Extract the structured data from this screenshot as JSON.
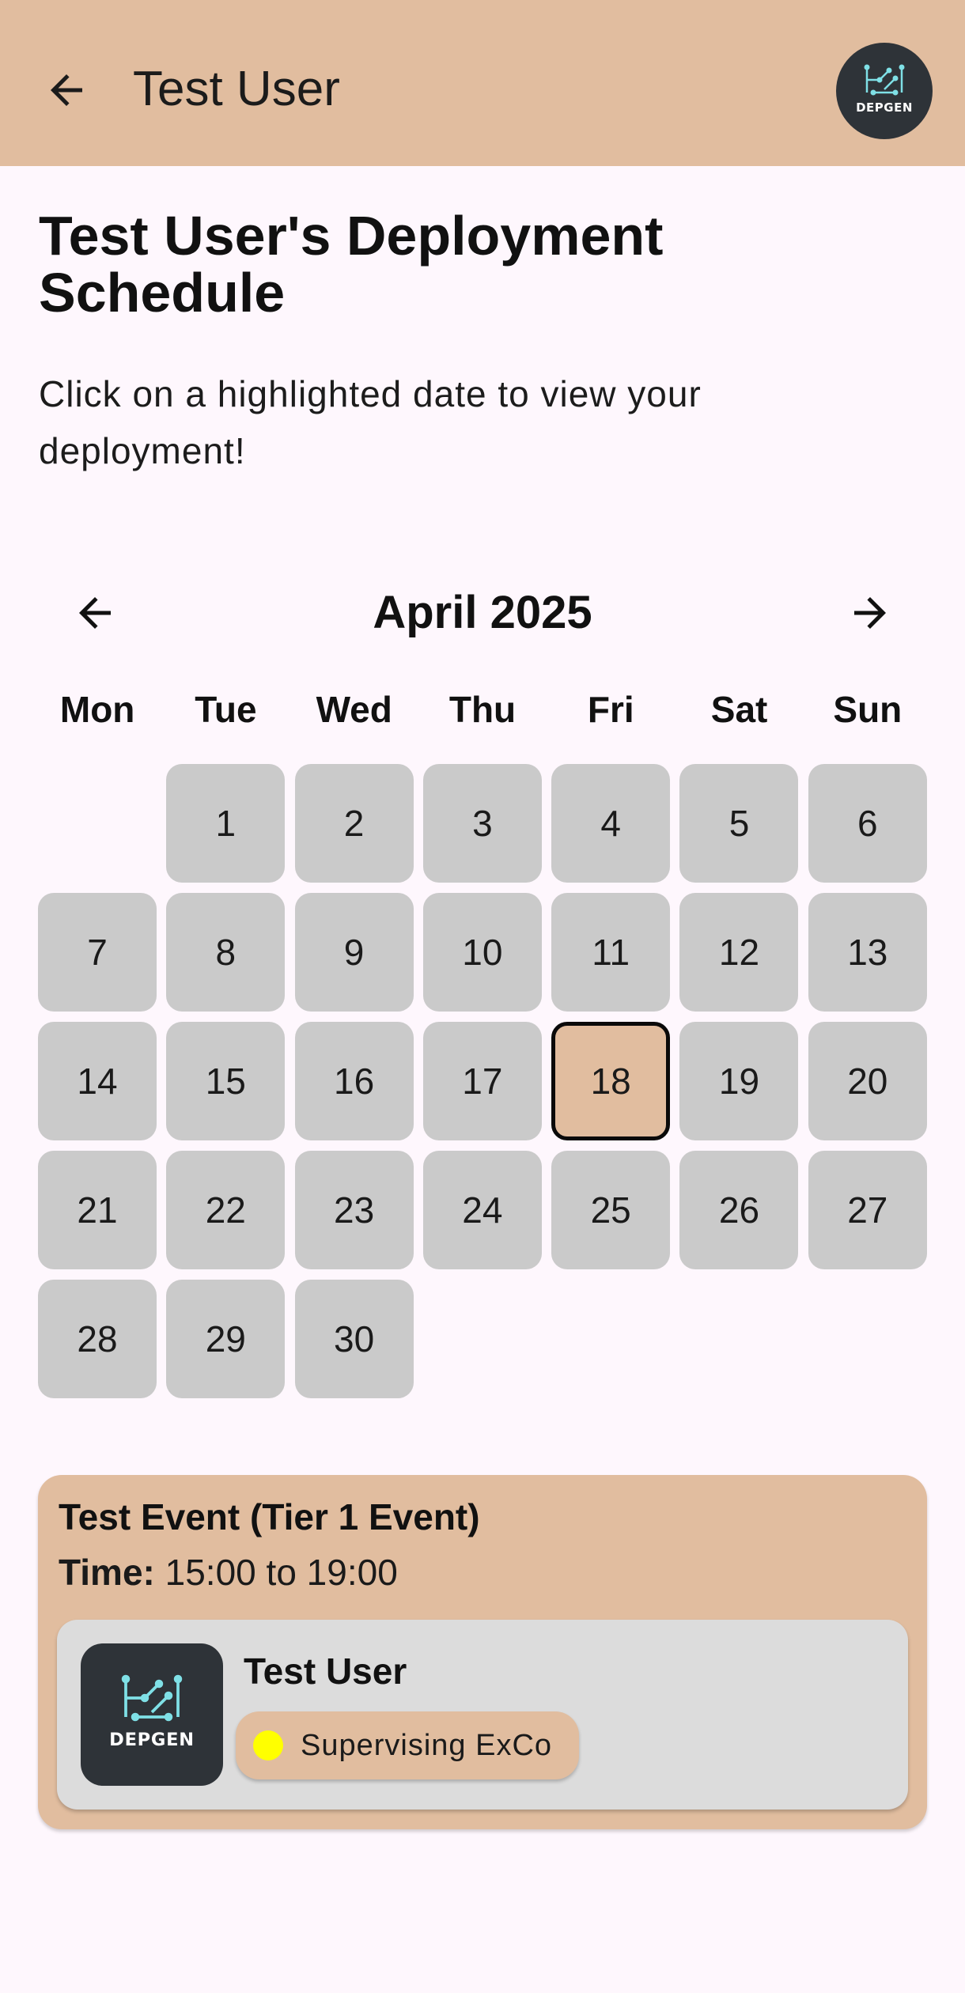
{
  "appbar": {
    "title": "Test User",
    "back_icon": "arrow-left-icon",
    "avatar_logo_text": "DEPGEN",
    "color": "#e1bd9f"
  },
  "page": {
    "title": "Test User's Deployment Schedule",
    "subtitle": "Click on a highlighted date to view your deployment!",
    "background": "#fef7fd"
  },
  "calendar": {
    "month_label": "April 2025",
    "prev_icon": "arrow-left-icon",
    "next_icon": "arrow-right-icon",
    "weekdays": [
      "Mon",
      "Tue",
      "Wed",
      "Thu",
      "Fri",
      "Sat",
      "Sun"
    ],
    "leading_blanks": 1,
    "days": [
      "1",
      "2",
      "3",
      "4",
      "5",
      "6",
      "7",
      "8",
      "9",
      "10",
      "11",
      "12",
      "13",
      "14",
      "15",
      "16",
      "17",
      "18",
      "19",
      "20",
      "21",
      "22",
      "23",
      "24",
      "25",
      "26",
      "27",
      "28",
      "29",
      "30"
    ],
    "selected_day": "18",
    "day_color": "#cacaca",
    "selected_color": "#e1bd9f"
  },
  "event": {
    "title": "Test Event (Tier 1 Event)",
    "time_label": "Time:",
    "time_value": "15:00 to 19:00",
    "member": {
      "name": "Test User",
      "avatar_logo_text": "DEPGEN",
      "role": "Supervising ExCo",
      "role_dot_color": "#ffff00"
    }
  }
}
